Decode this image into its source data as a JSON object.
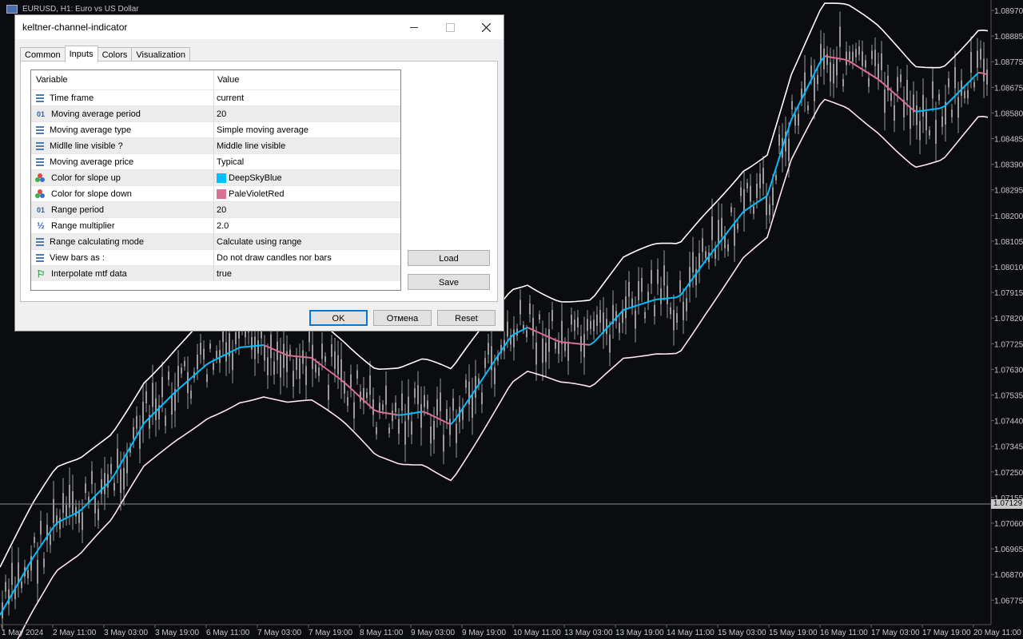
{
  "chart": {
    "title": "EURUSD, H1:  Euro vs US Dollar",
    "price_labels": [
      "1.08970",
      "1.08885",
      "1.08775",
      "1.08675",
      "1.08580",
      "1.08485",
      "1.08390",
      "1.08295",
      "1.08200",
      "1.08105",
      "1.08010",
      "1.07915",
      "1.07820",
      "1.07725",
      "1.07630",
      "1.07535",
      "1.07440",
      "1.07345",
      "1.07250",
      "1.07155",
      "1.07060",
      "1.06965",
      "1.06870",
      "1.06775"
    ],
    "current_price": "1.07129",
    "time_labels": [
      "1 May 2024",
      "2 May 11:00",
      "3 May 03:00",
      "3 May 19:00",
      "6 May 11:00",
      "7 May 03:00",
      "7 May 19:00",
      "8 May 11:00",
      "9 May 03:00",
      "9 May 19:00",
      "10 May 11:00",
      "13 May 03:00",
      "13 May 19:00",
      "14 May 11:00",
      "15 May 03:00",
      "15 May 19:00",
      "16 May 11:00",
      "17 May 03:00",
      "17 May 19:00",
      "20 May 11:00"
    ],
    "colors": {
      "up": "#00BFFF",
      "down": "#DB7093",
      "upper": "#ffffff",
      "lower": "#ffe6ea",
      "candle": "#9a9a9a"
    }
  },
  "dialog": {
    "title": "keltner-channel-indicator",
    "tabs": [
      "Common",
      "Inputs",
      "Colors",
      "Visualization"
    ],
    "active_tab": "Inputs",
    "columns": {
      "variable": "Variable",
      "value": "Value"
    },
    "rows": [
      {
        "icon": "list-icon",
        "variable": "Time frame",
        "value": "current"
      },
      {
        "icon": "number-icon",
        "variable": "Moving average period",
        "value": "20"
      },
      {
        "icon": "list-icon",
        "variable": "Moving average type",
        "value": "Simple moving average"
      },
      {
        "icon": "list-icon",
        "variable": "Midlle line visible ?",
        "value": "Middle line visible"
      },
      {
        "icon": "list-icon",
        "variable": "Moving average price",
        "value": "Typical"
      },
      {
        "icon": "color-icon",
        "variable": "Color for slope up",
        "value": "DeepSkyBlue",
        "swatch": "#00BFFF"
      },
      {
        "icon": "color-icon",
        "variable": "Color for slope down",
        "value": "PaleVioletRed",
        "swatch": "#DB7093"
      },
      {
        "icon": "number-icon",
        "variable": "Range period",
        "value": "20"
      },
      {
        "icon": "fraction-icon",
        "variable": "Range multiplier",
        "value": "2.0"
      },
      {
        "icon": "list-icon",
        "variable": "Range calculating mode",
        "value": "Calculate using range"
      },
      {
        "icon": "list-icon",
        "variable": "View bars as :",
        "value": "Do not draw candles nor bars"
      },
      {
        "icon": "flag-icon",
        "variable": "Interpolate mtf data",
        "value": "true"
      }
    ],
    "icon_glyphs": {
      "number": "01",
      "fraction": "½",
      "flag": "⚐"
    },
    "buttons": {
      "load": "Load",
      "save": "Save",
      "ok": "OK",
      "cancel": "Отмена",
      "reset": "Reset"
    }
  }
}
